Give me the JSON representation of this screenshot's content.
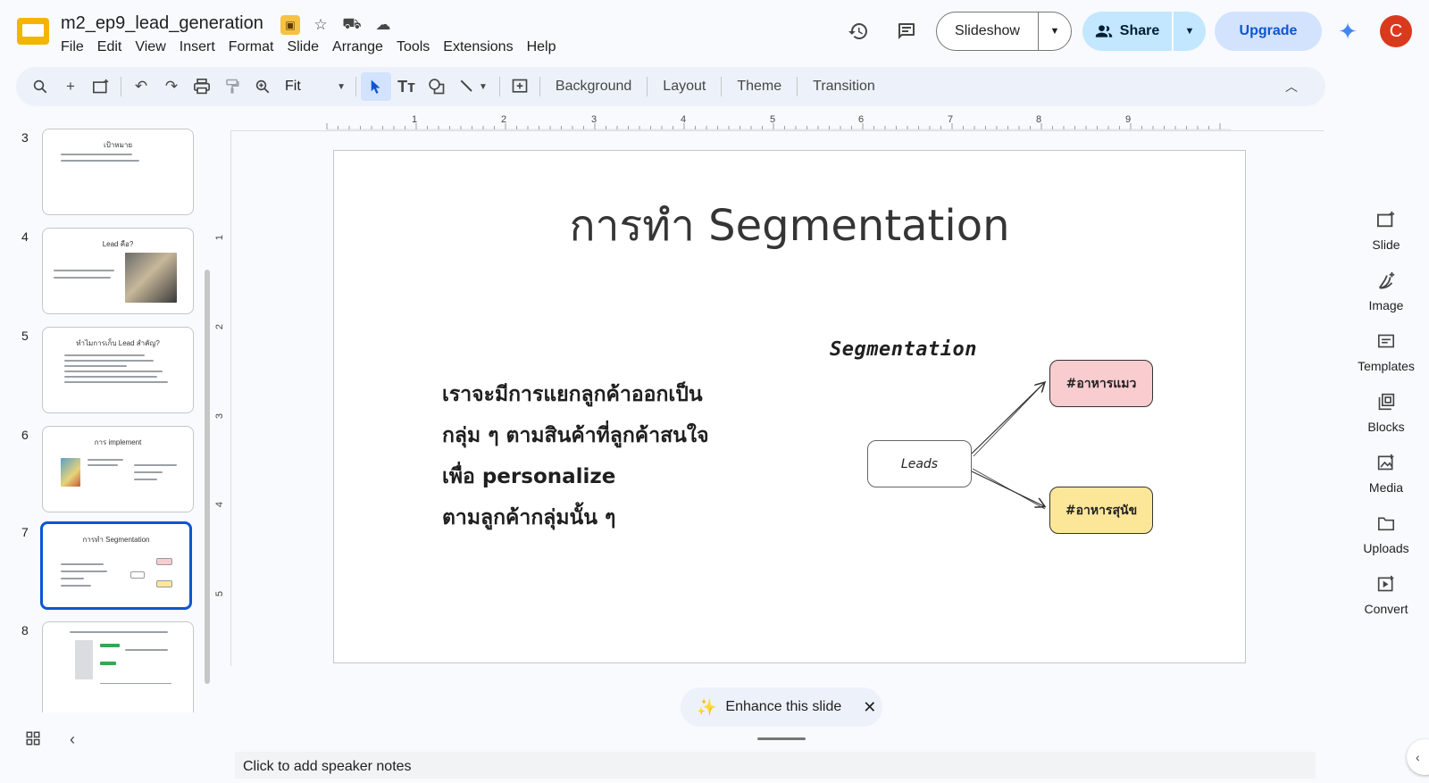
{
  "doc": {
    "title": "m2_ep9_lead_generation"
  },
  "menu": [
    "File",
    "Edit",
    "View",
    "Insert",
    "Format",
    "Slide",
    "Arrange",
    "Tools",
    "Extensions",
    "Help"
  ],
  "header": {
    "slideshow_label": "Slideshow",
    "share_label": "Share",
    "upgrade_label": "Upgrade",
    "avatar_initial": "C"
  },
  "toolbar": {
    "zoom": "Fit",
    "background_label": "Background",
    "layout_label": "Layout",
    "theme_label": "Theme",
    "transition_label": "Transition"
  },
  "filmstrip": [
    {
      "num": "3",
      "title": "เป้าหมาย"
    },
    {
      "num": "4",
      "title": "Lead คือ?"
    },
    {
      "num": "5",
      "title": "ทำไมการเก็บ Lead สำคัญ?"
    },
    {
      "num": "6",
      "title": "การ implement"
    },
    {
      "num": "7",
      "title": "การทำ Segmentation"
    },
    {
      "num": "8",
      "title": ""
    }
  ],
  "ruler": {
    "top": [
      "1",
      "2",
      "3",
      "4",
      "5",
      "6",
      "7",
      "8",
      "9"
    ],
    "left": [
      "1",
      "2",
      "3",
      "4",
      "5"
    ]
  },
  "slide": {
    "title": "การทำ Segmentation",
    "body_lines": [
      "เราจะมีการแยกลูกค้าออกเป็น",
      "กลุ่ม ๆ ตามสินค้าที่ลูกค้าสนใจ",
      "เพื่อ personalize",
      "ตามลูกค้ากลุ่มนั้น ๆ"
    ],
    "diagram": {
      "label": "Segmentation",
      "source": "Leads",
      "targets": [
        "#อาหารแมว",
        "#อาหารสุนัข"
      ]
    }
  },
  "enhance": {
    "label": "Enhance this slide"
  },
  "notes": {
    "placeholder": "Click to add speaker notes"
  },
  "side_panel": [
    "Slide",
    "Image",
    "Templates",
    "Blocks",
    "Media",
    "Uploads",
    "Convert"
  ],
  "colors": {
    "accent": "#0b57d0",
    "share_bg": "#c2e7ff",
    "upgrade_bg": "#d3e3fd",
    "avatar": "#d93a1e",
    "node_cat": "#f9ccd0",
    "node_dog": "#fce799"
  }
}
